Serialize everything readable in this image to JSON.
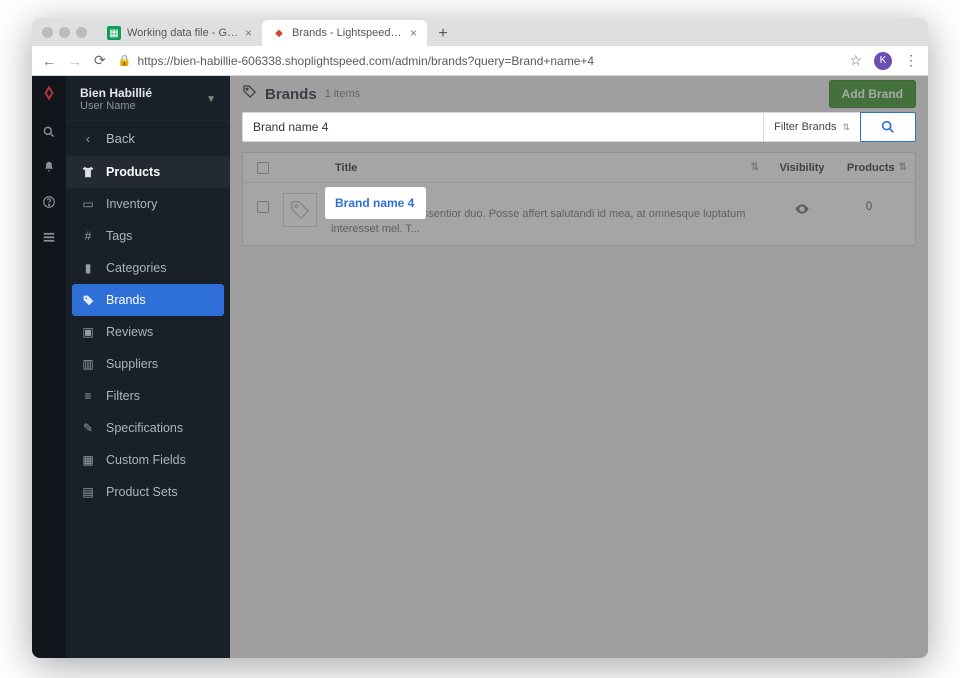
{
  "browser": {
    "tabs": [
      {
        "title": "Working data file - Google She",
        "active": false
      },
      {
        "title": "Brands - Lightspeed eCom",
        "active": true
      }
    ],
    "url": "https://bien-habillie-606338.shoplightspeed.com/admin/brands?query=Brand+name+4",
    "avatar_initial": "K"
  },
  "sidebar": {
    "site_name": "Bien Habillié",
    "user_label": "User Name",
    "back_label": "Back",
    "items": [
      {
        "label": "Products",
        "icon": "👕",
        "head": true
      },
      {
        "label": "Inventory",
        "icon": "card"
      },
      {
        "label": "Tags",
        "icon": "#"
      },
      {
        "label": "Categories",
        "icon": "folder"
      },
      {
        "label": "Brands",
        "icon": "tag",
        "active": true
      },
      {
        "label": "Reviews",
        "icon": "chat"
      },
      {
        "label": "Suppliers",
        "icon": "chart"
      },
      {
        "label": "Filters",
        "icon": "sliders"
      },
      {
        "label": "Specifications",
        "icon": "wrench"
      },
      {
        "label": "Custom Fields",
        "icon": "grid"
      },
      {
        "label": "Product Sets",
        "icon": "stack"
      }
    ]
  },
  "page": {
    "title": "Brands",
    "count_label": "1 items",
    "add_button": "Add Brand",
    "search_value": "Brand name 4",
    "filter_label": "Filter Brands",
    "columns": {
      "title": "Title",
      "visibility": "Visibility",
      "products": "Products"
    },
    "row": {
      "name": "Brand name 4",
      "desc": "Ei autem audiam assentior duo. Posse affert salutandi id mea, at omnesque luptatum interesset mel. T...",
      "products": "0"
    },
    "highlight_name": "Brand name 4"
  }
}
